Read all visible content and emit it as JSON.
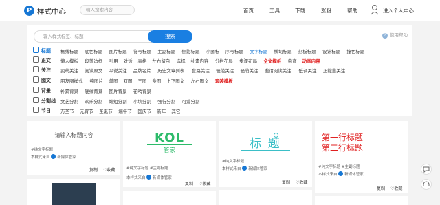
{
  "header": {
    "logo_letter": "P",
    "brand": "样式中心",
    "search_placeholder": "输入搜索内容",
    "nav": [
      "首页",
      "工具",
      "下载",
      "涨粉",
      "帮助"
    ],
    "user": "进入个人中心"
  },
  "search": {
    "placeholder": "输入样式标签、标题",
    "button": "搜索",
    "help_icon": "?",
    "help": "使用帮助"
  },
  "categories": [
    {
      "label": "标题",
      "icon": "title-icon",
      "tags": [
        "框线标题",
        "底色标题",
        "图片标题",
        "符号标题",
        "主副标题",
        "侧影标题",
        "小图标",
        "序号标题",
        "文字标题",
        "横切标题",
        "刻板标题",
        "设计标题",
        "撞色标题"
      ]
    },
    {
      "label": "正文",
      "icon": "text-icon",
      "tags": [
        "懒人模板",
        "段落边框",
        "引用",
        "对话",
        "表格",
        "左右留白",
        "选择",
        "补素内容",
        "分栏布局",
        "步骤布局",
        "全文模板",
        "电商",
        "动画内容"
      ]
    },
    {
      "label": "关注",
      "icon": "follow-icon",
      "tags": [
        "卖萌关注",
        "阅读原文",
        "平说关注",
        "品牌名片",
        "历史文章列表",
        "套路关注",
        "骚范关注",
        "骚萌关注",
        "邀请阅读关注",
        "低调关注",
        "正能量关注"
      ]
    },
    {
      "label": "图文",
      "icon": "image-text-icon",
      "tags": [
        "朋友圈样式",
        "纯图片",
        "单图",
        "双图",
        "三图",
        "多图",
        "上下图文",
        "左右图文",
        "套装模板"
      ]
    },
    {
      "label": "背景",
      "icon": "background-icon",
      "tags": [
        "补素背景",
        "底纹背景",
        "图片背景",
        "花哨背景"
      ]
    },
    {
      "label": "分割线",
      "icon": "divider-icon",
      "tags": [
        "文艺分割",
        "欢乐分割",
        "端短分割",
        "小块分割",
        "强行分割",
        "可爱分割"
      ]
    },
    {
      "label": "节日",
      "icon": "festival-icon",
      "tags": [
        "万圣节",
        "元宵节",
        "圣诞节",
        "端午节",
        "国庆节",
        "新年",
        "其它"
      ]
    }
  ],
  "highlight_tags": {
    "文字标题": "blue",
    "全文模板": "red",
    "动画内容": "red",
    "套装模板": "red"
  },
  "cards": [
    {
      "preview": [
        "请输入标题内容"
      ],
      "tags": "#纯文字标题",
      "author": "本样式来自",
      "source": "新媒体管家",
      "copy": "复制",
      "fav": "收藏"
    },
    {
      "preview": [
        "KOL",
        "管家"
      ],
      "tags": "#纯文字标题 #主副标题",
      "author": "本样式来自",
      "source": "新媒体管家",
      "copy": "复制",
      "fav": "收藏"
    },
    {
      "preview": [
        "标 题"
      ],
      "tags": "#纯文字标题",
      "author": "本样式来自",
      "source": "新媒体管家",
      "copy": "复制",
      "fav": "收藏"
    },
    {
      "preview": [
        "第一行标题",
        "第二行标题"
      ],
      "tags": "#纯文字标题 #主副标题",
      "author": "本样式来自",
      "source": "新媒体管家",
      "copy": "复制",
      "fav": "收藏"
    }
  ],
  "colors": {
    "brand": "#1677d4",
    "red": "#e02020",
    "green": "#2dbb6a",
    "teal": "#3bbfc7"
  }
}
